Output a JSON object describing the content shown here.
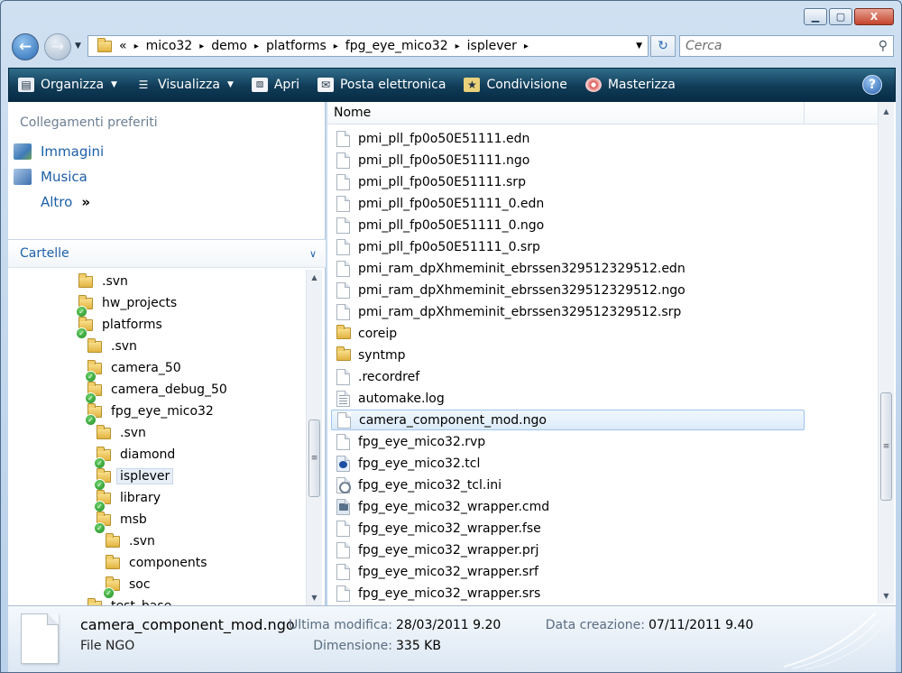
{
  "window": {
    "buttons": {
      "minimize": "▁",
      "maximize": "▢",
      "close": "X"
    }
  },
  "nav": {
    "breadcrumb_prefix": "«",
    "crumbs": [
      "mico32",
      "demo",
      "platforms",
      "fpg_eye_mico32",
      "isplever"
    ],
    "search_placeholder": "Cerca"
  },
  "toolbar": {
    "organize": "Organizza",
    "view": "Visualizza",
    "open": "Apri",
    "email": "Posta elettronica",
    "share": "Condivisione",
    "burn": "Masterizza",
    "help": "?"
  },
  "favorites": {
    "title": "Collegamenti preferiti",
    "items": [
      "Immagini",
      "Musica"
    ],
    "more": "Altro",
    "more_glyph": "»"
  },
  "folders": {
    "title": "Cartelle",
    "tree": [
      {
        "label": ".svn",
        "check": false
      },
      {
        "label": "hw_projects",
        "check": true
      },
      {
        "label": "platforms",
        "check": true
      },
      {
        "label": ".svn",
        "check": false
      },
      {
        "label": "camera_50",
        "check": true
      },
      {
        "label": "camera_debug_50",
        "check": true
      },
      {
        "label": "fpg_eye_mico32",
        "check": true
      },
      {
        "label": ".svn",
        "check": false
      },
      {
        "label": "diamond",
        "check": true
      },
      {
        "label": "isplever",
        "check": true,
        "selected": true
      },
      {
        "label": "library",
        "check": true
      },
      {
        "label": "msb",
        "check": true
      },
      {
        "label": ".svn",
        "check": false
      },
      {
        "label": "components",
        "check": false
      },
      {
        "label": "soc",
        "check": true
      },
      {
        "label": "test_base",
        "check": true
      }
    ]
  },
  "files": {
    "column_name": "Nome",
    "items": [
      {
        "name": "pmi_pll_fp0o50E51111.edn",
        "icon": "doc"
      },
      {
        "name": "pmi_pll_fp0o50E51111.ngo",
        "icon": "doc"
      },
      {
        "name": "pmi_pll_fp0o50E51111.srp",
        "icon": "doc"
      },
      {
        "name": "pmi_pll_fp0o50E51111_0.edn",
        "icon": "doc"
      },
      {
        "name": "pmi_pll_fp0o50E51111_0.ngo",
        "icon": "doc"
      },
      {
        "name": "pmi_pll_fp0o50E51111_0.srp",
        "icon": "doc"
      },
      {
        "name": "pmi_ram_dpXhmeminit_ebrssen329512329512.edn",
        "icon": "doc"
      },
      {
        "name": "pmi_ram_dpXhmeminit_ebrssen329512329512.ngo",
        "icon": "doc"
      },
      {
        "name": "pmi_ram_dpXhmeminit_ebrssen329512329512.srp",
        "icon": "doc"
      },
      {
        "name": "coreip",
        "icon": "folder"
      },
      {
        "name": "syntmp",
        "icon": "folder"
      },
      {
        "name": ".recordref",
        "icon": "doc"
      },
      {
        "name": "automake.log",
        "icon": "log"
      },
      {
        "name": "camera_component_mod.ngo",
        "icon": "doc",
        "selected": true
      },
      {
        "name": "fpg_eye_mico32.rvp",
        "icon": "doc"
      },
      {
        "name": "fpg_eye_mico32.tcl",
        "icon": "tcl"
      },
      {
        "name": "fpg_eye_mico32_tcl.ini",
        "icon": "ini"
      },
      {
        "name": "fpg_eye_mico32_wrapper.cmd",
        "icon": "cmd"
      },
      {
        "name": "fpg_eye_mico32_wrapper.fse",
        "icon": "doc"
      },
      {
        "name": "fpg_eye_mico32_wrapper.prj",
        "icon": "doc"
      },
      {
        "name": "fpg_eye_mico32_wrapper.srf",
        "icon": "doc"
      },
      {
        "name": "fpg_eye_mico32_wrapper.srs",
        "icon": "doc"
      }
    ]
  },
  "details": {
    "name": "camera_component_mod.ngo",
    "type": "File NGO",
    "modified_label": "Ultima modifica:",
    "modified_value": "28/03/2011 9.20",
    "size_label": "Dimensione:",
    "size_value": "335 KB",
    "created_label": "Data creazione:",
    "created_value": "07/11/2011 9.40"
  }
}
